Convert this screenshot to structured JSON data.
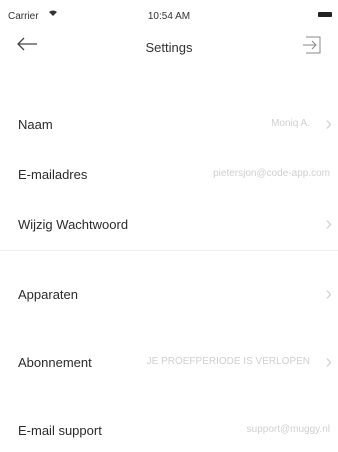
{
  "status_bar": {
    "carrier": "Carrier",
    "time": "10:54 AM"
  },
  "header": {
    "title": "Settings",
    "back_icon": "arrow-left-icon",
    "action_icon": "logout-icon"
  },
  "rows": [
    {
      "label": "Naam",
      "value": "Moniq A."
    },
    {
      "label": "E-mailadres",
      "value": "pietersjon@code-app.com"
    },
    {
      "label": "Wijzig Wachtwoord",
      "value": ""
    },
    {
      "label": "Apparaten",
      "value": ""
    },
    {
      "label": "Abonnement",
      "value": "JE PROEFPERIODE IS VERLOPEN"
    },
    {
      "label": "E-mail support",
      "value": "support@muggy.nl"
    }
  ]
}
